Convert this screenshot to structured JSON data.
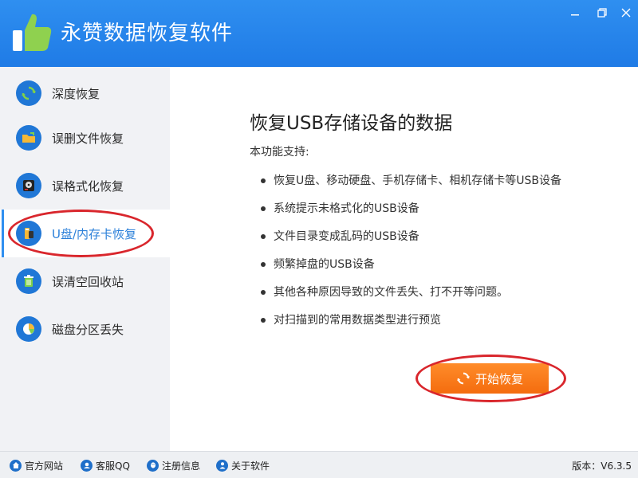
{
  "app": {
    "title": "永赞数据恢复软件",
    "logo_icon": "thumbs-up-icon"
  },
  "window_controls": {
    "minimize_icon": "minimize-icon",
    "maximize_icon": "maximize-icon",
    "close_icon": "close-icon"
  },
  "sidebar": {
    "items": [
      {
        "label": "深度恢复",
        "icon": "refresh-icon",
        "active": false
      },
      {
        "label": "误删文件恢复",
        "icon": "folder-icon",
        "active": false
      },
      {
        "label": "误格式化恢复",
        "icon": "disk-icon",
        "active": false
      },
      {
        "label": "U盘/内存卡恢复",
        "icon": "usb-card-icon",
        "active": true
      },
      {
        "label": "误清空回收站",
        "icon": "recycle-bin-icon",
        "active": false
      },
      {
        "label": "磁盘分区丢失",
        "icon": "pie-chart-icon",
        "active": false
      }
    ]
  },
  "main": {
    "title": "恢复USB存储设备的数据",
    "support_label": "本功能支持:",
    "features": [
      "恢复U盘、移动硬盘、手机存储卡、相机存储卡等USB设备",
      "系统提示未格式化的USB设备",
      "文件目录变成乱码的USB设备",
      "频繁掉盘的USB设备",
      "其他各种原因导致的文件丢失、打不开等问题。",
      "对扫描到的常用数据类型进行预览"
    ],
    "start_button": "开始恢复"
  },
  "footer": {
    "links": [
      {
        "label": "官方网站",
        "icon": "home-icon"
      },
      {
        "label": "客服QQ",
        "icon": "support-icon"
      },
      {
        "label": "注册信息",
        "icon": "qq-icon"
      },
      {
        "label": "关于软件",
        "icon": "person-icon"
      }
    ],
    "version": "版本：V6.3.5"
  },
  "colors": {
    "header": "#2f8ff0",
    "accent": "#2a7fd9",
    "button": "#f46c0e",
    "annotation": "#d9262c"
  }
}
